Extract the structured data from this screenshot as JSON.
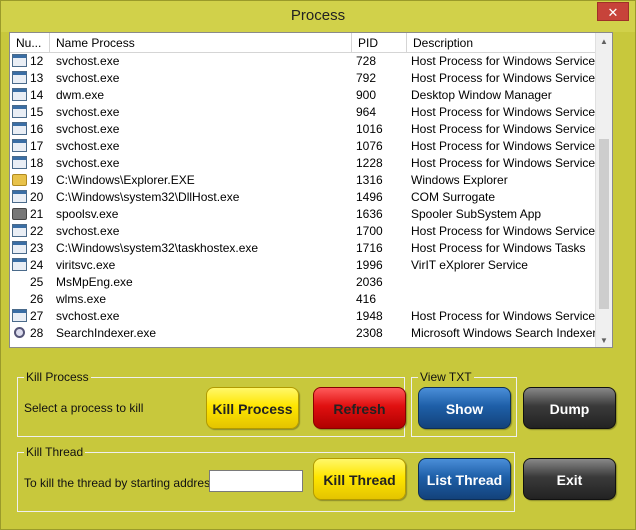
{
  "window": {
    "title": "Process",
    "close_glyph": "✕"
  },
  "list": {
    "columns": [
      "Nu...",
      "Name Process",
      "PID",
      "Description"
    ],
    "rows": [
      {
        "num": "12",
        "name": "svchost.exe",
        "pid": "728",
        "desc": "Host Process for Windows Services",
        "icon": "window-icon"
      },
      {
        "num": "13",
        "name": "svchost.exe",
        "pid": "792",
        "desc": "Host Process for Windows Services",
        "icon": "window-icon"
      },
      {
        "num": "14",
        "name": "dwm.exe",
        "pid": "900",
        "desc": "Desktop Window Manager",
        "icon": "window-icon"
      },
      {
        "num": "15",
        "name": "svchost.exe",
        "pid": "964",
        "desc": "Host Process for Windows Services",
        "icon": "window-icon"
      },
      {
        "num": "16",
        "name": "svchost.exe",
        "pid": "1016",
        "desc": "Host Process for Windows Services",
        "icon": "window-icon"
      },
      {
        "num": "17",
        "name": "svchost.exe",
        "pid": "1076",
        "desc": "Host Process for Windows Services",
        "icon": "window-icon"
      },
      {
        "num": "18",
        "name": "svchost.exe",
        "pid": "1228",
        "desc": "Host Process for Windows Services",
        "icon": "window-icon"
      },
      {
        "num": "19",
        "name": "C:\\Windows\\Explorer.EXE",
        "pid": "1316",
        "desc": "Windows Explorer",
        "icon": "folder-icon"
      },
      {
        "num": "20",
        "name": "C:\\Windows\\system32\\DllHost.exe",
        "pid": "1496",
        "desc": "COM Surrogate",
        "icon": "window-icon"
      },
      {
        "num": "21",
        "name": "spoolsv.exe",
        "pid": "1636",
        "desc": "Spooler SubSystem App",
        "icon": "printer-icon"
      },
      {
        "num": "22",
        "name": "svchost.exe",
        "pid": "1700",
        "desc": "Host Process for Windows Services",
        "icon": "window-icon"
      },
      {
        "num": "23",
        "name": "C:\\Windows\\system32\\taskhostex.exe",
        "pid": "1716",
        "desc": "Host Process for Windows Tasks",
        "icon": "window-icon"
      },
      {
        "num": "24",
        "name": "viritsvc.exe",
        "pid": "1996",
        "desc": "VirIT eXplorer Service",
        "icon": "window-icon"
      },
      {
        "num": "25",
        "name": "MsMpEng.exe",
        "pid": "2036",
        "desc": "",
        "icon": ""
      },
      {
        "num": "26",
        "name": "wlms.exe",
        "pid": "416",
        "desc": "",
        "icon": ""
      },
      {
        "num": "27",
        "name": "svchost.exe",
        "pid": "1948",
        "desc": "Host Process for Windows Services",
        "icon": "window-icon"
      },
      {
        "num": "28",
        "name": "SearchIndexer.exe",
        "pid": "2308",
        "desc": "Microsoft Windows Search Indexer",
        "icon": "search-icon"
      }
    ]
  },
  "kill_process": {
    "group_label": "Kill Process",
    "hint": "Select a process to kill",
    "kill_label": "Kill Process",
    "refresh_label": "Refresh"
  },
  "view_txt": {
    "group_label": "View TXT",
    "show_label": "Show",
    "dump_label": "Dump"
  },
  "kill_thread": {
    "group_label": "Kill Thread",
    "hint": "To kill the thread by starting address:",
    "address_value": "",
    "kill_label": "Kill Thread",
    "list_label": "List Thread",
    "exit_label": "Exit"
  },
  "colors": {
    "window_bg": "#c8c83c",
    "yellow_button": "#ffe600",
    "red_button": "#e01010",
    "blue_button": "#1e5fa8",
    "gray_button": "#3a3a3a"
  }
}
